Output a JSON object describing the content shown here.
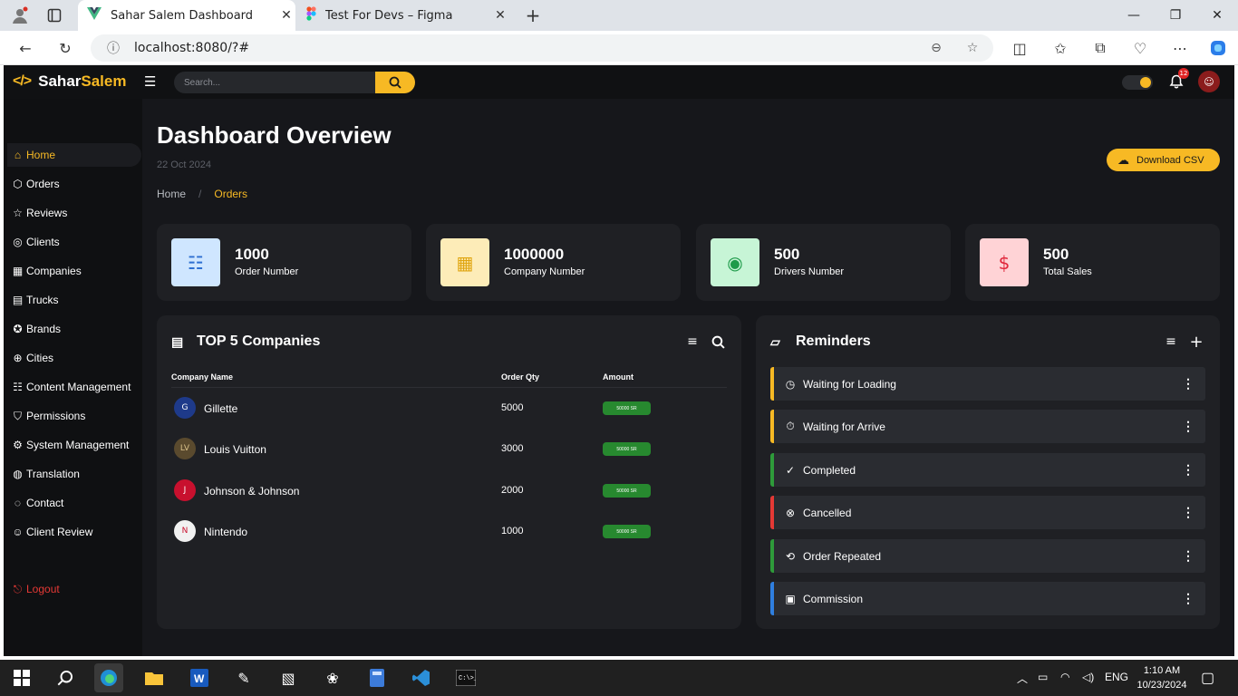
{
  "browser": {
    "tabs": [
      {
        "label": "Sahar Salem Dashboard",
        "icon": "vue-icon"
      },
      {
        "label": "Test For Devs – Figma",
        "icon": "figma-icon"
      }
    ],
    "url": "localhost:8080/?#"
  },
  "topbar": {
    "brand_first": "Sahar",
    "brand_second": "Salem",
    "search_placeholder": "Search...",
    "notification_count": "12"
  },
  "sidebar": {
    "items": [
      {
        "label": "Home",
        "icon": "home-icon"
      },
      {
        "label": "Orders",
        "icon": "box-icon"
      },
      {
        "label": "Reviews",
        "icon": "star-icon"
      },
      {
        "label": "Clients",
        "icon": "user-circle-icon"
      },
      {
        "label": "Companies",
        "icon": "building-icon"
      },
      {
        "label": "Trucks",
        "icon": "truck-icon"
      },
      {
        "label": "Brands",
        "icon": "medal-icon"
      },
      {
        "label": "Cities",
        "icon": "globe-icon"
      },
      {
        "label": "Content Management",
        "icon": "list-icon"
      },
      {
        "label": "Permissions",
        "icon": "shield-icon"
      },
      {
        "label": "System Management",
        "icon": "gear-icon"
      },
      {
        "label": "Translation",
        "icon": "globe-icon"
      },
      {
        "label": "Contact",
        "icon": "chat-icon"
      },
      {
        "label": "Client Review",
        "icon": "smile-icon"
      }
    ],
    "logout_label": "Logout"
  },
  "page": {
    "title": "Dashboard Overview",
    "date": "22 Oct 2024",
    "breadcrumb": [
      "Home",
      "/",
      "Orders"
    ],
    "download_label": "Download CSV"
  },
  "stats": [
    {
      "value": "1000",
      "label": "Order Number",
      "icon": "list-icon",
      "color": "#cfe6ff"
    },
    {
      "value": "1000000",
      "label": "Company Number",
      "icon": "building-icon",
      "color": "#fdecb8"
    },
    {
      "value": "500",
      "label": "Drivers Number",
      "icon": "user-circle-icon",
      "color": "#c7f5d6"
    },
    {
      "value": "500",
      "label": "Total Sales",
      "icon": "dollar-icon",
      "color": "#ffd3d6"
    }
  ],
  "companies": {
    "title": "TOP 5 Companies",
    "columns": [
      "Company Name",
      "Order Qty",
      "Amount"
    ],
    "rows": [
      {
        "name": "Gillette",
        "qty": "5000",
        "amount": "50000 SR"
      },
      {
        "name": "Louis Vuitton",
        "qty": "3000",
        "amount": "50000 SR"
      },
      {
        "name": "Johnson & Johnson",
        "qty": "2000",
        "amount": "50000 SR"
      },
      {
        "name": "Nintendo",
        "qty": "1000",
        "amount": "50000 SR"
      }
    ]
  },
  "reminders": {
    "title": "Reminders",
    "items": [
      {
        "label": "Waiting for Loading",
        "icon": "clock-icon",
        "color": "#f7b924"
      },
      {
        "label": "Waiting for Arrive",
        "icon": "stopwatch-icon",
        "color": "#f7b924"
      },
      {
        "label": "Completed",
        "icon": "check-circle-icon",
        "color": "#2e9b3a"
      },
      {
        "label": "Cancelled",
        "icon": "x-circle-icon",
        "color": "#e53935"
      },
      {
        "label": "Order Repeated",
        "icon": "repeat-icon",
        "color": "#2e9b3a"
      },
      {
        "label": "Commission",
        "icon": "message-icon",
        "color": "#2f7fe0"
      }
    ]
  },
  "taskbar": {
    "language": "ENG",
    "time": "1:10 AM",
    "date": "10/23/2024"
  }
}
